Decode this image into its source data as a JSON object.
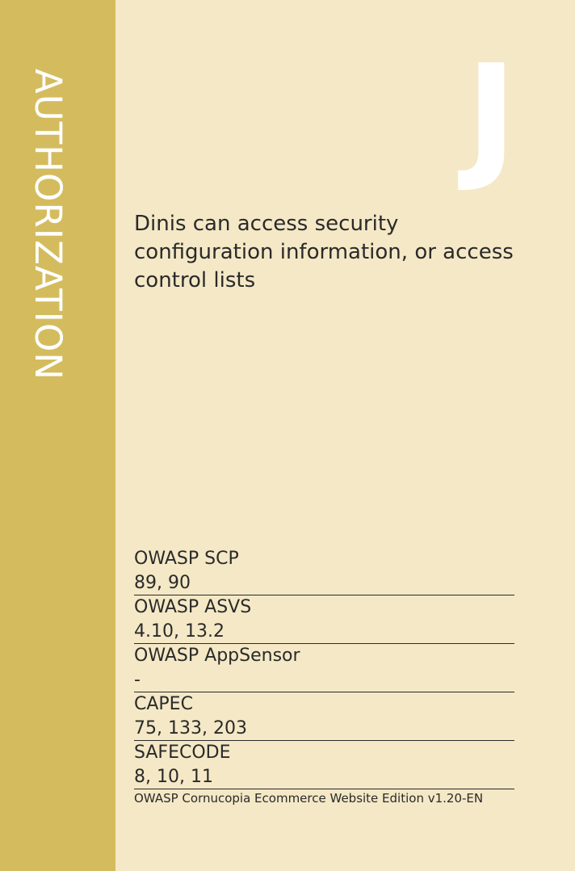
{
  "card": {
    "suit": "AUTHORIZATION",
    "letter": "J",
    "description": "Dinis can access security configuration information, or access control lists",
    "references": [
      {
        "name": "OWASP SCP",
        "value": "89, 90"
      },
      {
        "name": "OWASP ASVS",
        "value": "4.10, 13.2"
      },
      {
        "name": "OWASP AppSensor",
        "value": "-"
      },
      {
        "name": "CAPEC",
        "value": "75, 133, 203"
      },
      {
        "name": "SAFECODE",
        "value": "8, 10, 11"
      }
    ],
    "footer": "OWASP Cornucopia Ecommerce Website Edition v1.20-EN"
  },
  "colors": {
    "background": "#f4e8c6",
    "sidebar": "#d4bc5e",
    "text": "#2a2a2a",
    "accent_text": "#ffffff"
  }
}
